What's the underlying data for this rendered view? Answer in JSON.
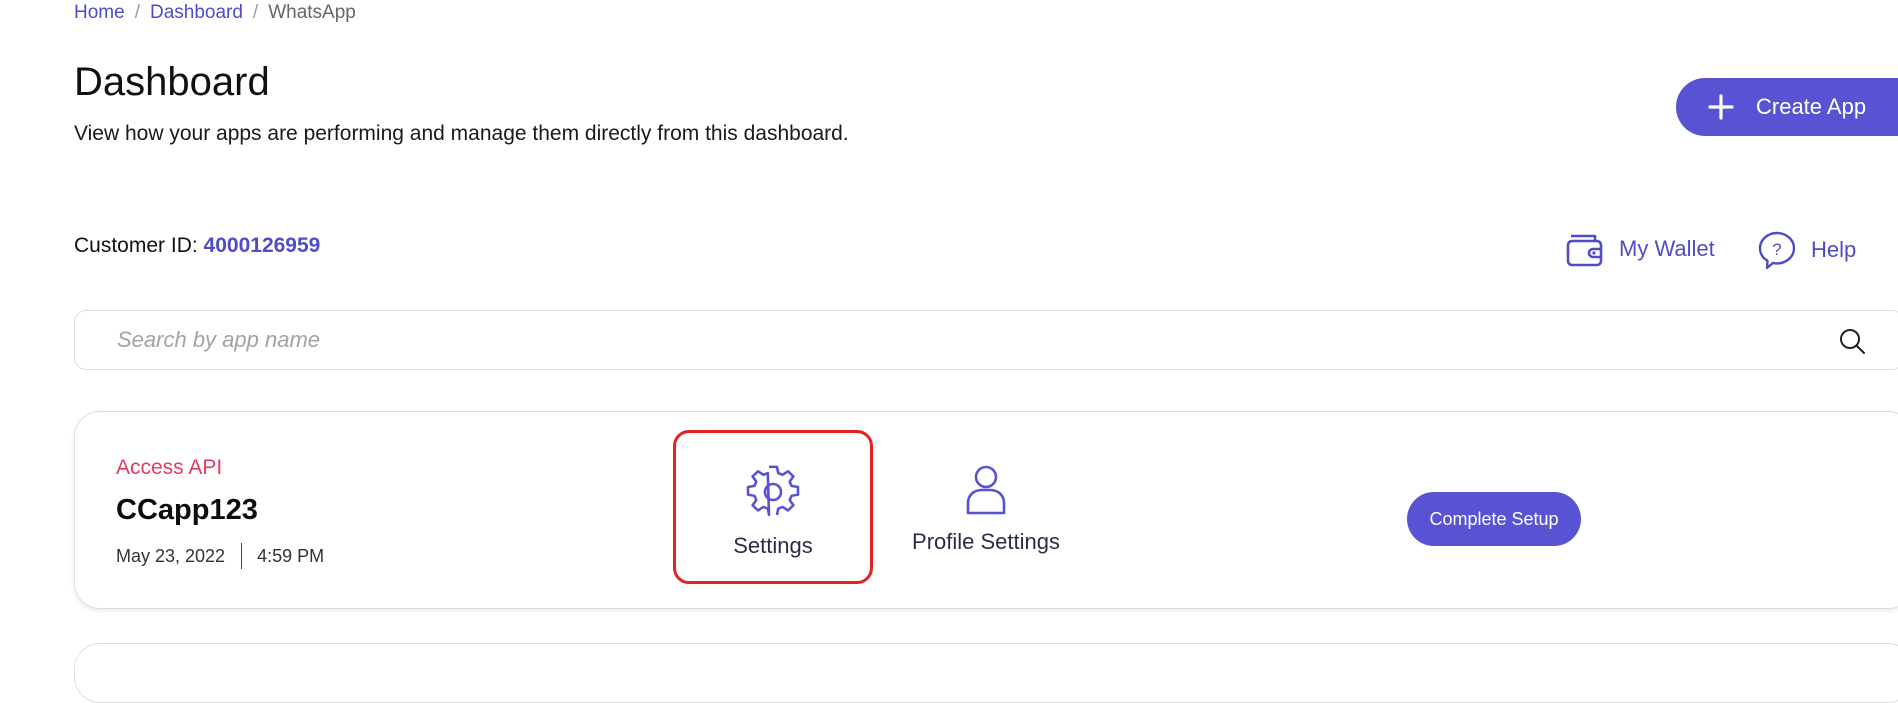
{
  "breadcrumb": {
    "home": "Home",
    "dashboard": "Dashboard",
    "current": "WhatsApp",
    "separator": "/"
  },
  "header": {
    "title": "Dashboard",
    "subtitle": "View how your apps are performing and manage them directly from this dashboard.",
    "create_app_label": "Create App"
  },
  "customer": {
    "label": "Customer ID:",
    "id": "4000126959"
  },
  "top_actions": {
    "wallet_label": "My Wallet",
    "help_label": "Help"
  },
  "search": {
    "placeholder": "Search by app name",
    "value": ""
  },
  "apps": [
    {
      "status": "Access API",
      "name": "CCapp123",
      "date": "May 23, 2022",
      "time": "4:59 PM",
      "settings_label": "Settings",
      "profile_settings_label": "Profile Settings",
      "complete_setup_label": "Complete Setup"
    }
  ],
  "colors": {
    "accent": "#5753d3",
    "link": "#4f4cc7",
    "status": "#e8385f",
    "highlight": "#e02424"
  },
  "icons": [
    "plus-icon",
    "wallet-icon",
    "help-icon",
    "search-icon",
    "gear-icon",
    "person-icon"
  ]
}
